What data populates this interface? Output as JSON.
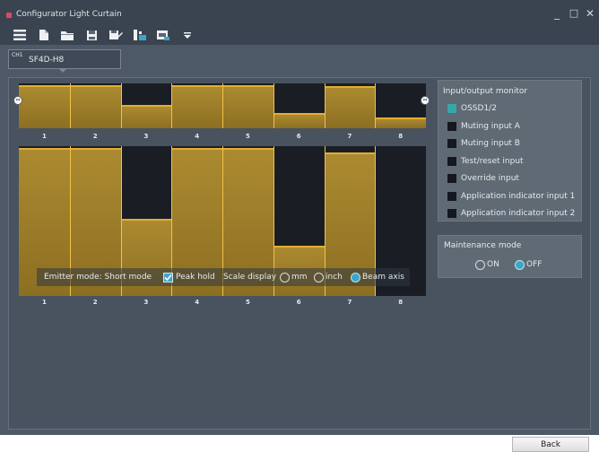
{
  "window": {
    "title": "Configurator Light Curtain",
    "minimize_glyph": "_",
    "maximize_glyph": "□",
    "close_glyph": "✕"
  },
  "toolbar": {
    "icons": [
      "menu-icon",
      "new-file-icon",
      "open-folder-icon",
      "save-icon",
      "save-as-icon",
      "read-device-icon",
      "write-device-icon",
      "dropdown-arrow-icon"
    ]
  },
  "channel": {
    "prefix": "CH1",
    "name": "SF4D-H8"
  },
  "chart_data": [
    {
      "type": "bar",
      "categories": [
        "1",
        "2",
        "3",
        "4",
        "5",
        "6",
        "7",
        "8"
      ],
      "values": [
        1.0,
        1.0,
        0.55,
        1.0,
        1.0,
        0.35,
        0.98,
        0.25
      ],
      "ylim": [
        0,
        1
      ]
    },
    {
      "type": "bar",
      "categories": [
        "1",
        "2",
        "3",
        "4",
        "5",
        "6",
        "7",
        "8"
      ],
      "values": [
        1.0,
        1.0,
        0.52,
        1.0,
        1.0,
        0.34,
        0.97,
        0.0
      ],
      "ylim": [
        0,
        1
      ]
    }
  ],
  "emitter": {
    "mode_label": "Emitter mode: Short mode",
    "peak_hold_label": "Peak hold",
    "peak_hold_checked": true,
    "scale_label": "Scale display",
    "scale_options": [
      "mm",
      "inch",
      "Beam axis"
    ],
    "scale_selected": "Beam axis"
  },
  "io_monitor": {
    "title": "Input/output monitor",
    "items": [
      {
        "label": "OSSD1/2",
        "active": true
      },
      {
        "label": "Muting input A",
        "active": false
      },
      {
        "label": "Muting input B",
        "active": false
      },
      {
        "label": "Test/reset input",
        "active": false
      },
      {
        "label": "Override input",
        "active": false
      },
      {
        "label": "Application indicator input 1",
        "active": false
      },
      {
        "label": "Application indicator input 2",
        "active": false
      }
    ]
  },
  "maintenance": {
    "title": "Maintenance mode",
    "on_label": "ON",
    "off_label": "OFF",
    "selected": "OFF"
  },
  "footer": {
    "back_label": "Back"
  },
  "colors": {
    "bar_fill": "#9c7c2a",
    "bar_edge": "#e4ad30",
    "chart_bg": "#1a1d24",
    "active_indicator": "#34a7a9",
    "radio_selected": "#3ba6c9"
  }
}
